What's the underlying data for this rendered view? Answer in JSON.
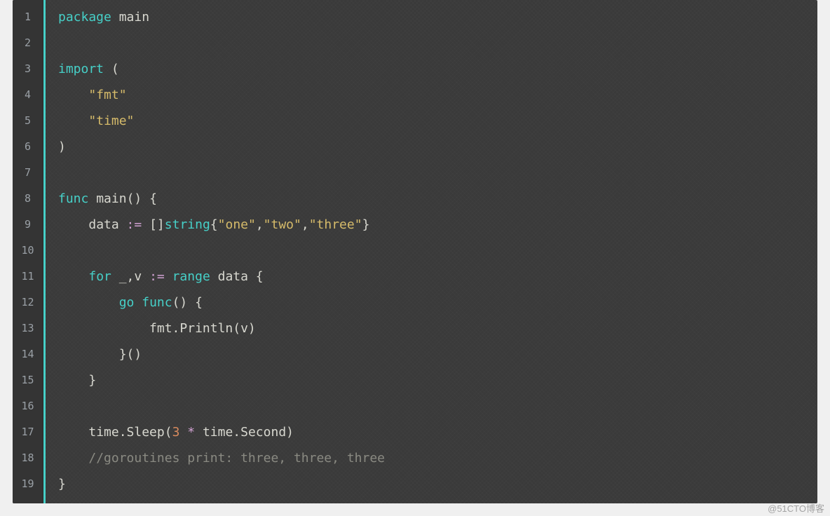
{
  "watermark": "@51CTO博客",
  "lines": [
    "1",
    "2",
    "3",
    "4",
    "5",
    "6",
    "7",
    "8",
    "9",
    "10",
    "11",
    "12",
    "13",
    "14",
    "15",
    "16",
    "17",
    "18",
    "19"
  ],
  "code": {
    "l1_package": "package",
    "l1_main": " main",
    "l3_import": "import",
    "l3_paren": " (",
    "l4_indent": "    ",
    "l4_str": "\"fmt\"",
    "l5_indent": "    ",
    "l5_str": "\"time\"",
    "l6_close": ")",
    "l8_func": "func",
    "l8_sp": " ",
    "l8_main": "main",
    "l8_after": "() {",
    "l9_indent": "    ",
    "l9_data": "data ",
    "l9_assign": ":=",
    "l9_sp": " ",
    "l9_a": "[]",
    "l9_ty": "string",
    "l9_b": "{",
    "l9_s1": "\"one\"",
    "l9_c1": ",",
    "l9_s2": "\"two\"",
    "l9_c2": ",",
    "l9_s3": "\"three\"",
    "l9_c": "}",
    "l11_indent": "    ",
    "l11_for": "for",
    "l11_a": " _,v ",
    "l11_assign": ":=",
    "l11_sp": " ",
    "l11_range": "range",
    "l11_b": " data {",
    "l12_indent": "        ",
    "l12_go": "go",
    "l12_sp": " ",
    "l12_func": "func",
    "l12_rest": "() {",
    "l13_indent": "            ",
    "l13_txt": "fmt.Println(v)",
    "l14_indent": "        ",
    "l14_txt": "}()",
    "l15_indent": "    ",
    "l15_txt": "}",
    "l17_indent": "    ",
    "l17_a": "time.Sleep(",
    "l17_num": "3",
    "l17_sp": " ",
    "l17_star": "*",
    "l17_b": " time.Second)",
    "l18_indent": "    ",
    "l18_cmt": "//goroutines print: three, three, three",
    "l19_txt": "}"
  }
}
